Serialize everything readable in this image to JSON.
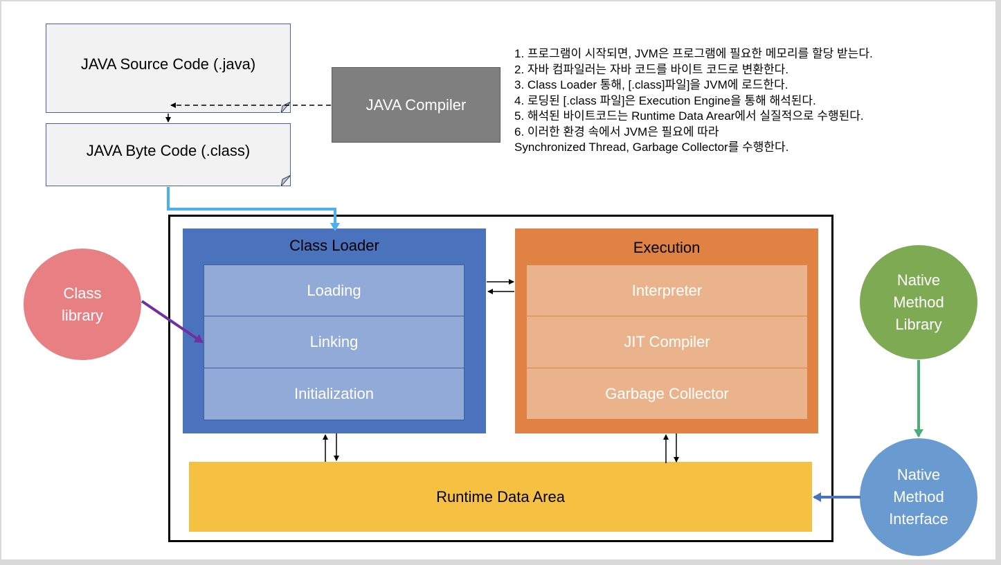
{
  "source_box": {
    "label": "JAVA Source Code (.java)"
  },
  "bytecode_box": {
    "label": "JAVA Byte Code (.class)"
  },
  "compiler_box": {
    "label": "JAVA Compiler"
  },
  "notes": [
    "1.  프로그램이 시작되면, JVM은 프로그램에 필요한 메모리를 할당 받는다.",
    "2.  자바 컴파일러는 자바 코드를 바이트 코드로 변환한다.",
    "3.  Class Loader 통해, [.class]파일]을 JVM에 로드한다.",
    "4.  로딩된 [.class 파일]은 Execution Engine을 통해 해석된다.",
    "5.  해석된 바이트코드는 Runtime Data Arear에서 실질적으로 수행된다.",
    "6.  이러한 환경 속에서 JVM은 필요에 따라",
    "Synchronized Thread, Garbage Collector를 수행한다."
  ],
  "class_loader": {
    "title": "Class Loader",
    "color": "#4a72bd",
    "cell_color": "#91aad8",
    "steps": [
      "Loading",
      "Linking",
      "Initialization"
    ]
  },
  "execution": {
    "title": "Execution",
    "color": "#e08244",
    "cell_color": "#eab38b",
    "steps": [
      "Interpreter",
      "JIT Compiler",
      "Garbage Collector"
    ]
  },
  "runtime_data_area": {
    "label": "Runtime Data Area",
    "color": "#f6c142"
  },
  "class_library": {
    "line1": "Class",
    "line2": "library",
    "color": "#e88083"
  },
  "native_method_library": {
    "line1": "Native",
    "line2": "Method",
    "line3": "Library",
    "color": "#7faa54"
  },
  "native_method_interface": {
    "line1": "Native",
    "line2": "Method",
    "line3": "Interface",
    "color": "#6a9bd0"
  },
  "arrow_colors": {
    "bytecode_to_loader": "#4cb0ea",
    "class_library": "#7030a0",
    "native_library": "#4aad7c",
    "native_interface": "#4a72bd"
  }
}
